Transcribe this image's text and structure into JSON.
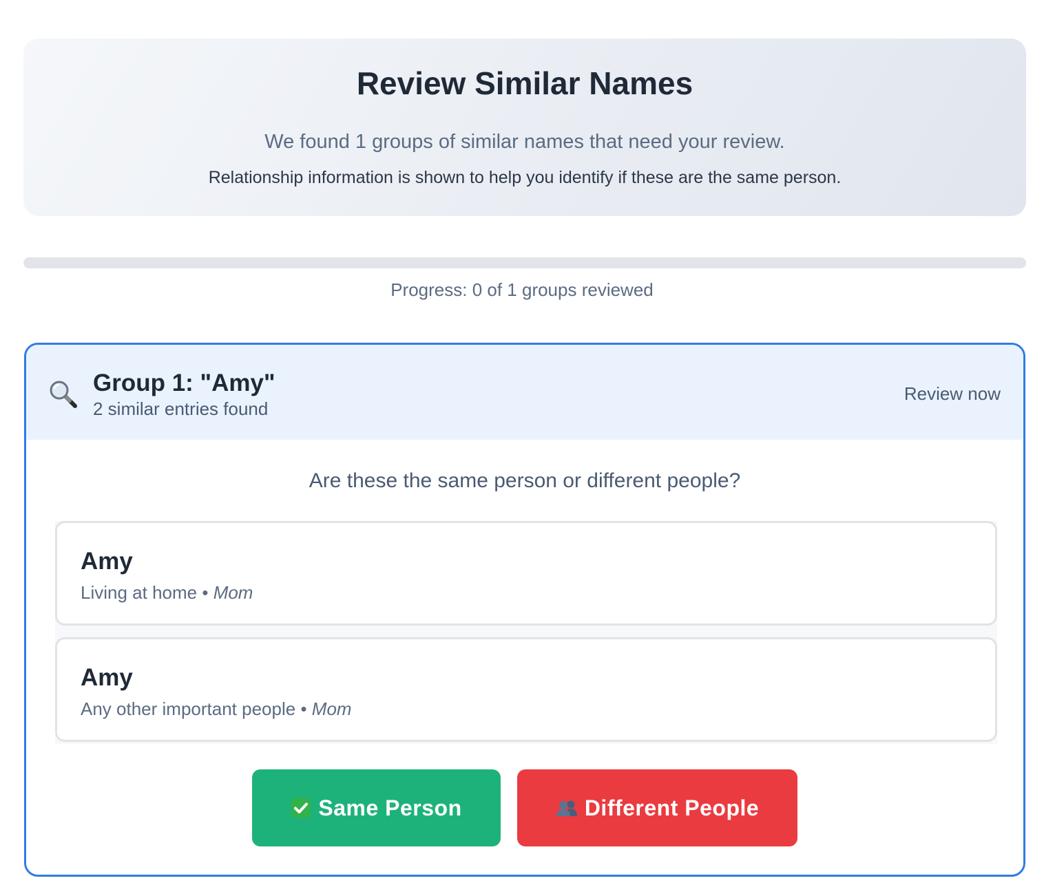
{
  "header": {
    "title": "Review Similar Names",
    "subtitle": "We found 1 groups of similar names that need your review.",
    "note": "Relationship information is shown to help you identify if these are the same person."
  },
  "progress": {
    "label": "Progress: 0 of 1 groups reviewed",
    "reviewed": 0,
    "total": 1,
    "fill_fraction": 0,
    "fill_color": "#3b82f6"
  },
  "group": {
    "icon": "magnifying-glass-icon",
    "title": "Group 1: \"Amy\"",
    "count_label": "2 similar entries found",
    "action_label": "Review now",
    "border_color": "#2f7be6",
    "question": "Are these the same person or different people?",
    "entries": [
      {
        "name": "Amy",
        "context": "Living at home",
        "separator": "•",
        "relationship": "Mom"
      },
      {
        "name": "Amy",
        "context": "Any other important people",
        "separator": "•",
        "relationship": "Mom"
      }
    ],
    "buttons": {
      "same_label": "Same Person",
      "same_icon": "check-box-icon",
      "same_color": "#1eb27b",
      "different_label": "Different People",
      "different_icon": "people-icon",
      "different_color": "#ea3b40"
    }
  }
}
